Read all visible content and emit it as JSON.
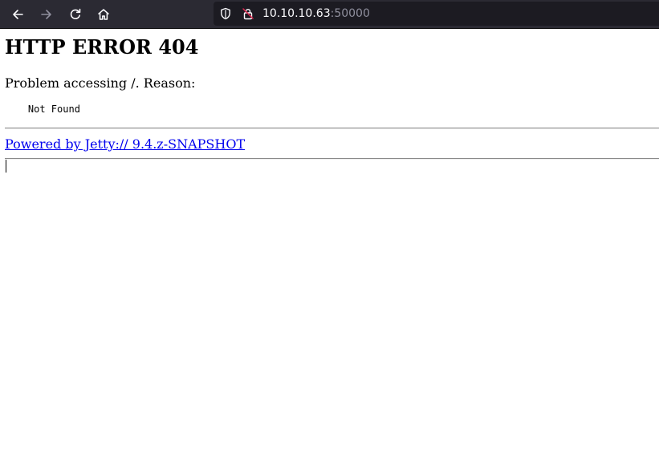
{
  "browser": {
    "url_host": "10.10.10.63",
    "url_port": ":50000",
    "icons": {
      "back": "back-arrow-icon",
      "forward": "forward-arrow-icon",
      "reload": "reload-icon",
      "home": "home-icon",
      "tracking_protection": "shield-icon",
      "connection": "insecure-lock-icon"
    },
    "colors": {
      "toolbar_bg": "#2b2a33",
      "urlbar_bg": "#1c1b22",
      "url_text": "#fbfbfe",
      "url_port_text": "#8f8f9d"
    }
  },
  "page": {
    "heading": "HTTP ERROR 404",
    "reason_line": "Problem accessing /. Reason:",
    "reason_detail": "    Not Found",
    "footer_link": "Powered by Jetty:// 9.4.z-SNAPSHOT",
    "colors": {
      "link": "#0000ee"
    }
  }
}
